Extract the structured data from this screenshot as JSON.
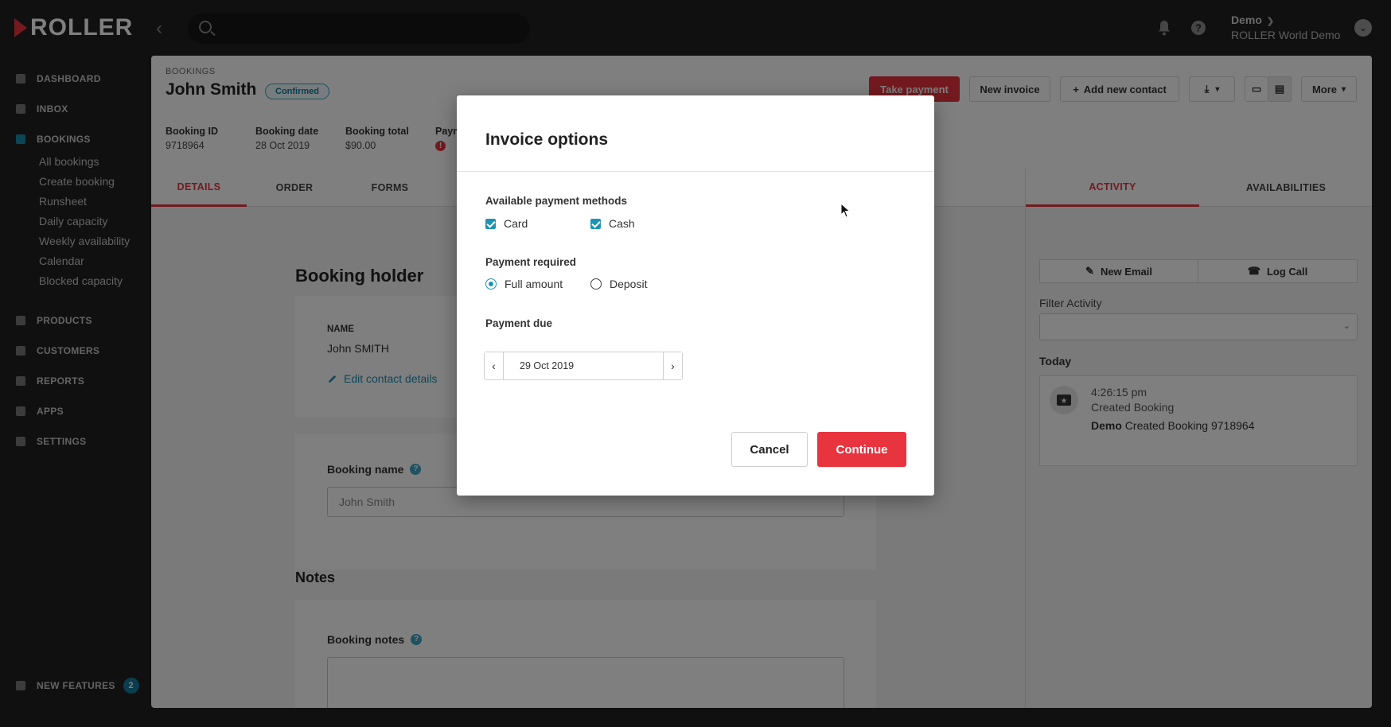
{
  "app": {
    "logo_text": "ROLLER",
    "brand_color": "#e8343f",
    "accent_color": "#1d93b5"
  },
  "topbar": {
    "search": {
      "placeholder": ""
    },
    "user": {
      "name": "Demo",
      "org": "ROLLER World Demo"
    }
  },
  "sidebar": {
    "items": [
      {
        "label": "DASHBOARD",
        "icon": "dashboard-icon"
      },
      {
        "label": "INBOX",
        "icon": "inbox-icon"
      },
      {
        "label": "BOOKINGS",
        "icon": "calendar-icon"
      },
      {
        "label": "PRODUCTS",
        "icon": "tag-icon"
      },
      {
        "label": "CUSTOMERS",
        "icon": "people-icon"
      },
      {
        "label": "REPORTS",
        "icon": "bar-chart-icon"
      },
      {
        "label": "APPS",
        "icon": "grid-icon"
      },
      {
        "label": "SETTINGS",
        "icon": "gear-icon"
      }
    ],
    "bookings_sub": [
      "All bookings",
      "Create booking",
      "Runsheet",
      "Daily capacity",
      "Weekly availability",
      "Calendar",
      "Blocked capacity"
    ],
    "new_features": {
      "label": "NEW FEATURES",
      "count": "2"
    }
  },
  "booking": {
    "breadcrumb": "BOOKINGS",
    "customer_name": "John Smith",
    "status": "Confirmed",
    "meta": [
      {
        "label": "Booking ID",
        "value": "9718964"
      },
      {
        "label": "Booking date",
        "value": "28 Oct 2019"
      },
      {
        "label": "Booking total",
        "value": "$90.00"
      }
    ],
    "payment_label": "Paym",
    "actions": {
      "take_payment": "Take payment",
      "new_invoice": "New invoice",
      "add_contact": "Add new contact",
      "more": "More"
    },
    "tabs": [
      "DETAILS",
      "ORDER",
      "FORMS"
    ],
    "right_tabs": [
      "ACTIVITY",
      "AVAILABILITIES"
    ],
    "holder": {
      "heading": "Booking holder",
      "name_label": "NAME",
      "name_value": "John SMITH",
      "edit_link": "Edit contact details",
      "booking_name_label": "Booking name",
      "booking_name_value": "John Smith"
    },
    "notes": {
      "heading": "Notes",
      "booking_notes_label": "Booking notes"
    }
  },
  "activity": {
    "new_email": "New Email",
    "log_call": "Log Call",
    "filter_label": "Filter Activity",
    "filter_value": "",
    "group": "Today",
    "entries": [
      {
        "time": "4:26:15 pm",
        "type": "Created Booking",
        "actor": "Demo",
        "text": "Created Booking 9718964"
      }
    ]
  },
  "modal": {
    "title": "Invoice options",
    "payment_methods_label": "Available payment methods",
    "methods": [
      {
        "label": "Card",
        "checked": true
      },
      {
        "label": "Cash",
        "checked": true
      }
    ],
    "payment_required_label": "Payment required",
    "required_options": [
      {
        "label": "Full amount",
        "selected": true
      },
      {
        "label": "Deposit",
        "selected": false
      }
    ],
    "payment_due_label": "Payment due",
    "payment_due_value": "29 Oct 2019",
    "cancel": "Cancel",
    "continue": "Continue"
  }
}
